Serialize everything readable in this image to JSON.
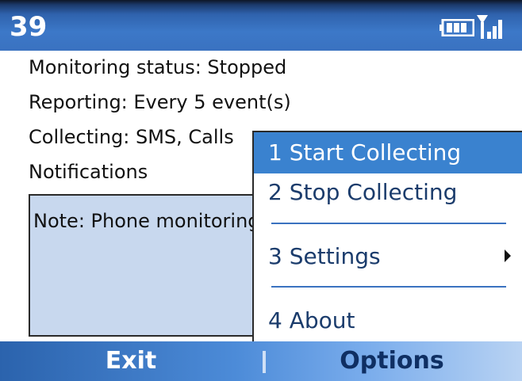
{
  "title_bar": {
    "title": "39",
    "icons": [
      "battery-icon",
      "signal-strength-icon"
    ]
  },
  "info": {
    "monitoring_status": "Monitoring status: Stopped",
    "reporting": "Reporting: Every 5 event(s)",
    "collecting": "Collecting: SMS, Calls",
    "notifications": "Notifications"
  },
  "note": {
    "text": "Note: Phone monitoring"
  },
  "menu": {
    "items": [
      {
        "label": "1 Start Collecting",
        "selected": true
      },
      {
        "label": "2 Stop Collecting",
        "selected": false
      },
      {
        "label": "3 Settings",
        "selected": false,
        "has_submenu": true
      },
      {
        "label": "4 About",
        "selected": false
      }
    ]
  },
  "softkeys": {
    "left": "Exit",
    "right": "Options"
  },
  "colors": {
    "title_bar": "#3c78c8",
    "menu_highlight": "#3a82cf",
    "menu_text": "#1b3c6c",
    "note_background": "#c8d8ee"
  }
}
